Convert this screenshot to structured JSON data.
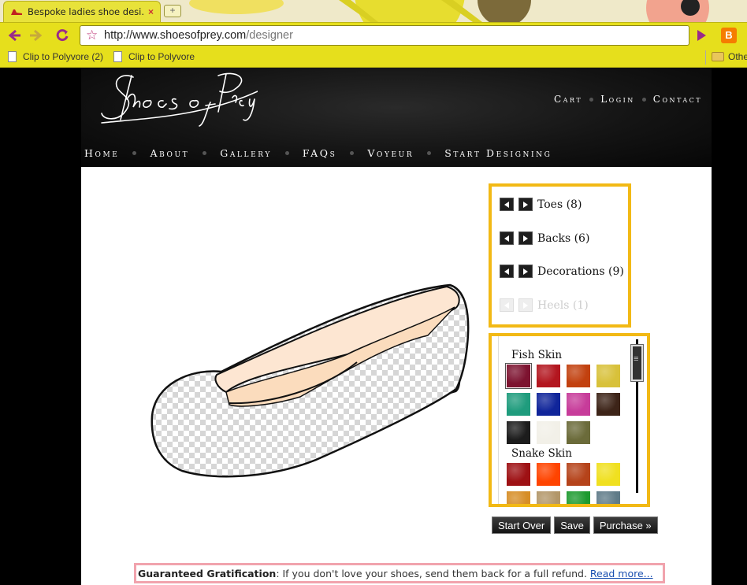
{
  "browser": {
    "tab_title": "Bespoke ladies shoe desi...",
    "tab_close": "×",
    "new_tab": "+",
    "url_host": "http://www.shoesofprey.com",
    "url_path": "/designer",
    "bookmarks": [
      "Clip to Polyvore (2)",
      "Clip to Polyvore",
      "Othe"
    ]
  },
  "site": {
    "logo_text": "Shoes of Prey",
    "util_nav": [
      "Cart",
      "Login",
      "Contact"
    ],
    "main_nav": [
      "Home",
      "About",
      "Gallery",
      "FAQs",
      "Voyeur",
      "Start Designing"
    ]
  },
  "designer": {
    "options": [
      {
        "label": "Toes (8)",
        "enabled": true
      },
      {
        "label": "Backs (6)",
        "enabled": true
      },
      {
        "label": "Decorations (9)",
        "enabled": true
      },
      {
        "label": "Heels (1)",
        "enabled": false
      }
    ],
    "materials": [
      {
        "title": "Fish Skin",
        "swatches": [
          "#7d1330",
          "#b3161f",
          "#c2410f",
          "#d8c13a",
          "#1f9c7d",
          "#10259a",
          "#c73c9a",
          "#3d2418",
          "#1c1c1c",
          "#f2f0e8",
          "#6b6b3a"
        ]
      },
      {
        "title": "Snake Skin",
        "swatches": [
          "#9e1114",
          "#ff4400",
          "#b5431a",
          "#f0e020",
          "#d68d25",
          "#b29668",
          "#1d9a2e",
          "#5f7b88"
        ]
      }
    ],
    "selected_swatch": "#7d1330",
    "actions": [
      "Start Over",
      "Save",
      "Purchase »"
    ]
  },
  "guarantee": {
    "heading": "Guaranteed Gratification",
    "text": ": If you don't love your shoes, send them back for a full refund. ",
    "link": "Read more..."
  },
  "colors": {
    "accent_border": "#f2b915",
    "guarantee_border": "#f1a3ad",
    "chrome_yellow": "#e6df1c"
  }
}
